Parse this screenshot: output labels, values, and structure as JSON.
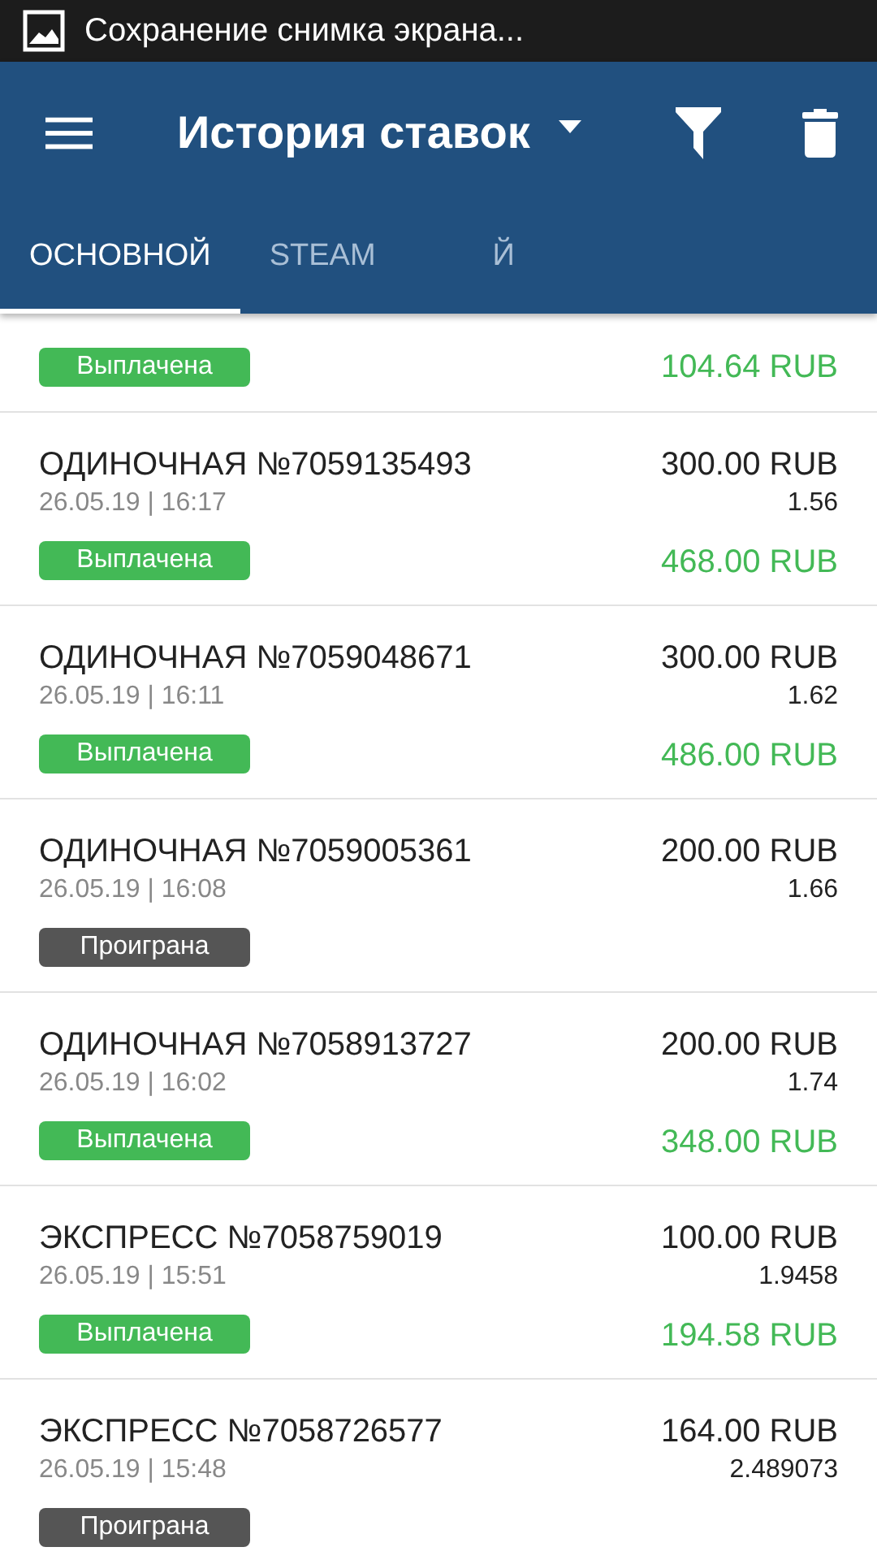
{
  "status_bar": {
    "notification": "Сохранение снимка экрана..."
  },
  "app_bar": {
    "title": "История ставок"
  },
  "tabs": [
    {
      "label": "ОСНОВНОЙ",
      "selected": true
    },
    {
      "label": "STEAM",
      "selected": false
    },
    {
      "label": "Й",
      "selected": false
    }
  ],
  "bets": [
    {
      "kind": "partial",
      "color": "#43b956",
      "status_label": "Выплачена",
      "payout": "104.64 RUB"
    },
    {
      "kind": "full",
      "title": "ОДИНОЧНАЯ №7059135493",
      "date": "26.05.19 | 16:17",
      "amount": "300.00 RUB",
      "odds": "1.56",
      "color": "#43b956",
      "status_label": "Выплачена",
      "payout": "468.00 RUB"
    },
    {
      "kind": "full",
      "title": "ОДИНОЧНАЯ №7059048671",
      "date": "26.05.19 | 16:11",
      "amount": "300.00 RUB",
      "odds": "1.62",
      "color": "#43b956",
      "status_label": "Выплачена",
      "payout": "486.00 RUB"
    },
    {
      "kind": "full",
      "title": "ОДИНОЧНАЯ №7059005361",
      "date": "26.05.19 | 16:08",
      "amount": "200.00 RUB",
      "odds": "1.66",
      "color": "#555555",
      "status_label": "Проиграна"
    },
    {
      "kind": "full",
      "title": "ОДИНОЧНАЯ №7058913727",
      "date": "26.05.19 | 16:02",
      "amount": "200.00 RUB",
      "odds": "1.74",
      "color": "#43b956",
      "status_label": "Выплачена",
      "payout": "348.00 RUB"
    },
    {
      "kind": "full",
      "title": "ЭКСПРЕСС №7058759019",
      "date": "26.05.19 | 15:51",
      "amount": "100.00 RUB",
      "odds": "1.9458",
      "color": "#43b956",
      "status_label": "Выплачена",
      "payout": "194.58 RUB"
    },
    {
      "kind": "full",
      "title": "ЭКСПРЕСС №7058726577",
      "date": "26.05.19 | 15:48",
      "amount": "164.00 RUB",
      "odds": "2.489073",
      "color": "#555555",
      "status_label": "Проиграна"
    }
  ]
}
